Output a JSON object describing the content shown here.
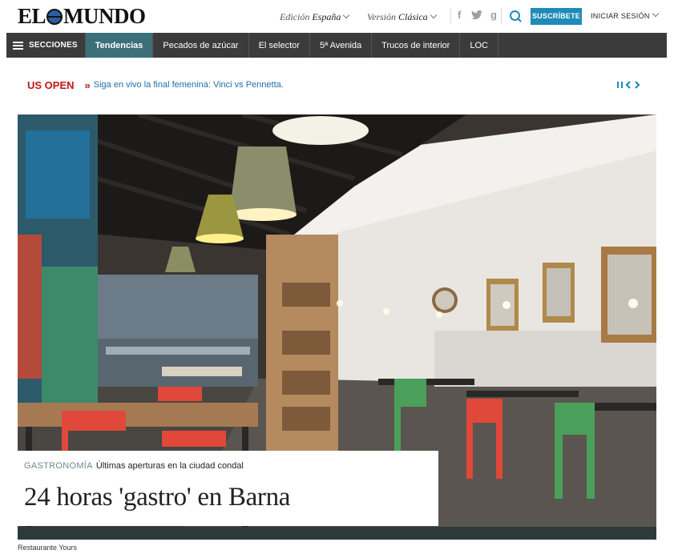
{
  "header": {
    "logo_left": "EL",
    "logo_right": "MUNDO",
    "edition_label": "Edición",
    "edition_value": "España",
    "version_label": "Versión",
    "version_value": "Clásica",
    "social": {
      "facebook": "f",
      "google": "g"
    },
    "subscribe": "SUSCRÍBETE",
    "login": "INICIAR SESIÓN"
  },
  "nav": {
    "menu_label": "SECCIONES",
    "items": [
      "Tendencias",
      "Pecados de azúcar",
      "El selector",
      "5ª Avenida",
      "Trucos de interior",
      "LOC"
    ]
  },
  "ticker": {
    "tag": "US OPEN",
    "arrows": "»",
    "text": "Siga en vivo la final femenina: Vinci vs Pennetta."
  },
  "article": {
    "section": "GASTRONOMÍA",
    "kicker": "Últimas aperturas en la ciudad condal",
    "headline": "24 horas 'gastro' en Barna",
    "photo_caption": "Restaurante Yours"
  },
  "colors": {
    "accent": "#1e8bb9",
    "nav_bg": "#3b3b3b",
    "nav_active": "#3b6f7a",
    "ticker_tag": "#c01718",
    "ticker_text": "#1e6fa5"
  }
}
